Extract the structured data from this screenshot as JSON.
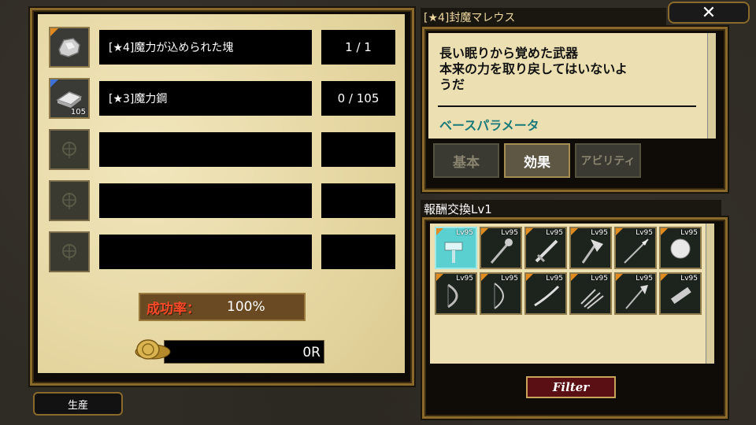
{
  "materials": [
    {
      "name": "[★4]魔力が込められた塊",
      "count": "1 / 1",
      "icon": "ore-chunk-icon",
      "rarity_color": "#e08a20",
      "qty": ""
    },
    {
      "name": "[★3]魔力鋼",
      "count": "0 / 105",
      "icon": "steel-ingot-icon",
      "rarity_color": "#3a72d8",
      "qty": "105"
    },
    {
      "name": "",
      "count": "",
      "icon": "empty-slot-icon",
      "qty": ""
    },
    {
      "name": "",
      "count": "",
      "icon": "empty-slot-icon",
      "qty": ""
    },
    {
      "name": "",
      "count": "",
      "icon": "empty-slot-icon",
      "qty": ""
    }
  ],
  "success": {
    "label": "成功率：",
    "value": "100%"
  },
  "cost": {
    "value": "0R"
  },
  "produce_button": "生産",
  "item": {
    "title": "[★4]封魔マレウス",
    "description_lines": [
      "長い眠りから覚めた武器",
      "本来の力を取り戻してはいないよ",
      "うだ"
    ],
    "base_parameter_label": "ベースパラメータ"
  },
  "close_button": "✕",
  "tabs": [
    {
      "label": "基本",
      "active": false
    },
    {
      "label": "効果",
      "active": true
    },
    {
      "label": "アビリティ",
      "active": false
    }
  ],
  "reward": {
    "title": "報酬交換Lv1",
    "items": [
      {
        "lv": "Lv95",
        "icon": "hammer-icon",
        "selected": true
      },
      {
        "lv": "Lv95",
        "icon": "mace-icon",
        "selected": false
      },
      {
        "lv": "Lv95",
        "icon": "sword-icon",
        "selected": false
      },
      {
        "lv": "Lv95",
        "icon": "axe-icon",
        "selected": false
      },
      {
        "lv": "Lv95",
        "icon": "spear-icon",
        "selected": false
      },
      {
        "lv": "Lv95",
        "icon": "orb-icon",
        "selected": false
      },
      {
        "lv": "Lv95",
        "icon": "bow-icon",
        "selected": false
      },
      {
        "lv": "Lv95",
        "icon": "longbow-icon",
        "selected": false
      },
      {
        "lv": "Lv95",
        "icon": "katana-icon",
        "selected": false
      },
      {
        "lv": "Lv95",
        "icon": "claw-icon",
        "selected": false
      },
      {
        "lv": "Lv95",
        "icon": "halberd-icon",
        "selected": false
      },
      {
        "lv": "Lv95",
        "icon": "gun-icon",
        "selected": false
      }
    ]
  },
  "filter_button": "Filter",
  "colors": {
    "accent_gold": "#8a6a2a",
    "parchment": "#ece0b2",
    "success_red": "#ff4a2a",
    "teal": "#1a7a7a"
  }
}
